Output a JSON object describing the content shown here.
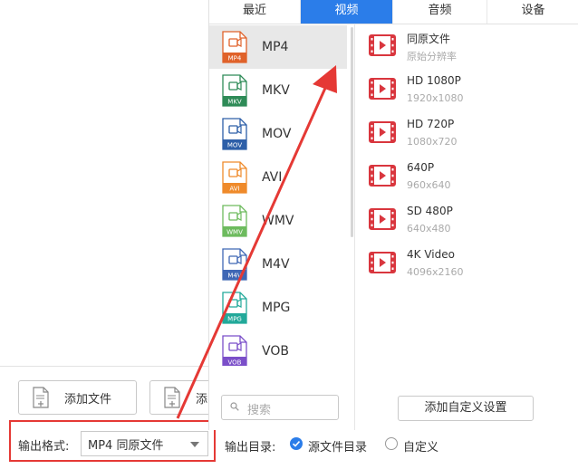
{
  "tabs": [
    {
      "label": "最近",
      "active": false
    },
    {
      "label": "视频",
      "active": true
    },
    {
      "label": "音频",
      "active": false
    },
    {
      "label": "设备",
      "active": false
    }
  ],
  "formats": [
    {
      "name": "MP4",
      "badge": "MP4",
      "color": "#e0622a",
      "selected": true
    },
    {
      "name": "MKV",
      "badge": "MKV",
      "color": "#2e8b57",
      "selected": false
    },
    {
      "name": "MOV",
      "badge": "MOV",
      "color": "#2d5fa8",
      "selected": false
    },
    {
      "name": "AVI",
      "badge": "AVI",
      "color": "#ef8a2a",
      "selected": false
    },
    {
      "name": "WMV",
      "badge": "WMV",
      "color": "#6dbb5e",
      "selected": false
    },
    {
      "name": "M4V",
      "badge": "M4V",
      "color": "#3f67b5",
      "selected": false
    },
    {
      "name": "MPG",
      "badge": "MPG",
      "color": "#22a99a",
      "selected": false
    },
    {
      "name": "VOB",
      "badge": "VOB",
      "color": "#7b4fc9",
      "selected": false
    }
  ],
  "resolutions": [
    {
      "title": "同原文件",
      "sub": "原始分辨率"
    },
    {
      "title": "HD 1080P",
      "sub": "1920x1080"
    },
    {
      "title": "HD 720P",
      "sub": "1080x720"
    },
    {
      "title": "640P",
      "sub": "960x640"
    },
    {
      "title": "SD 480P",
      "sub": "640x480"
    },
    {
      "title": "4K Video",
      "sub": "4096x2160"
    }
  ],
  "search": {
    "placeholder": "搜索"
  },
  "custom_settings_label": "添加自定义设置",
  "left": {
    "add_file_label": "添加文件",
    "add_folder_label": "添"
  },
  "output": {
    "format_label": "输出格式:",
    "format_value": "MP4 同原文件",
    "dir_label": "输出目录:",
    "dir_options": [
      {
        "label": "源文件目录",
        "checked": true
      },
      {
        "label": "自定义",
        "checked": false
      }
    ]
  },
  "colors": {
    "accent": "#2b7de9",
    "annotation": "#e53935",
    "play_icon": "#d9363e"
  }
}
